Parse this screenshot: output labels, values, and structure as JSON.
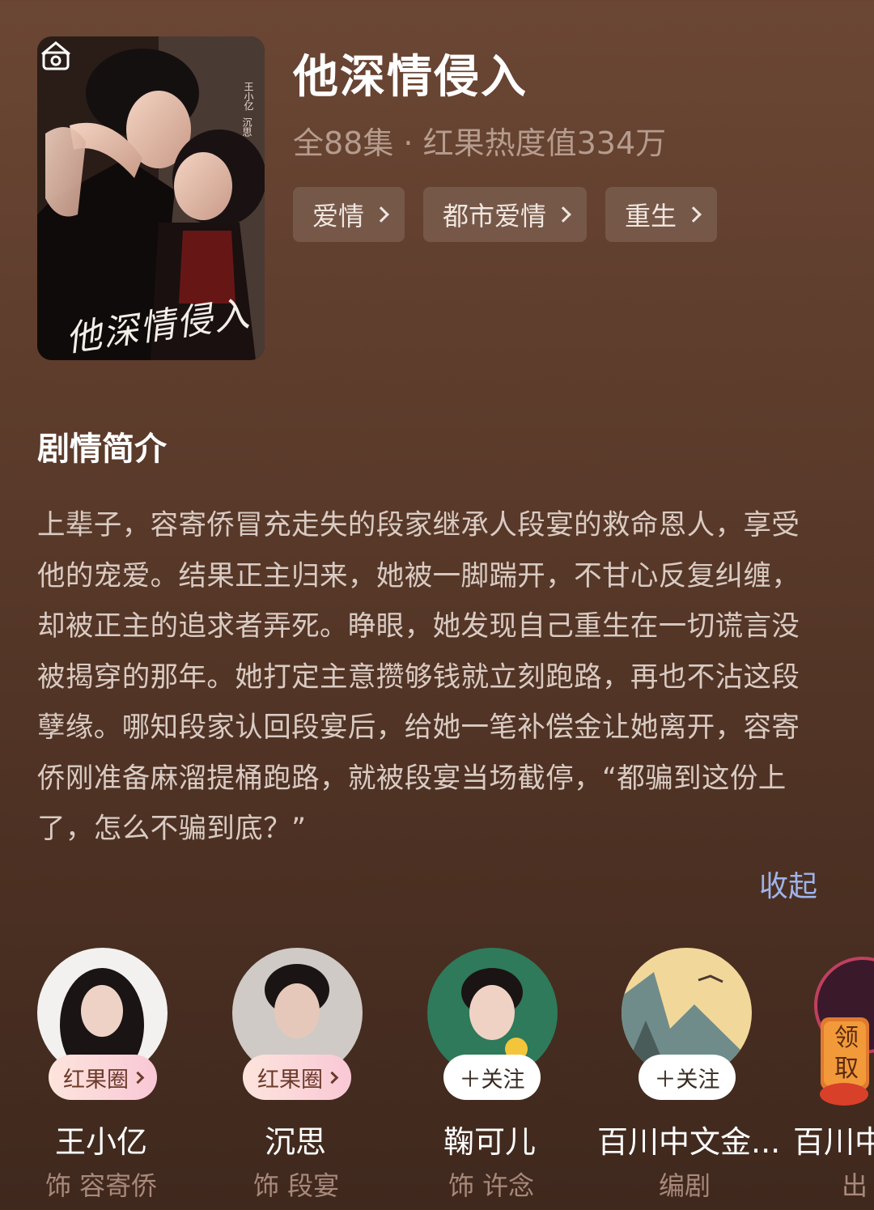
{
  "poster": {
    "title_art": "他深情侵入",
    "actor1": "王小亿",
    "actor2": "沉思"
  },
  "show": {
    "title": "他深情侵入",
    "meta": "全88集 · 红果热度值334万",
    "tags": [
      "爱情",
      "都市爱情",
      "重生"
    ]
  },
  "synopsis": {
    "heading": "剧情简介",
    "text": "上辈子，容寄侨冒充走失的段家继承人段宴的救命恩人，享受他的宠爱。结果正主归来，她被一脚踹开，不甘心反复纠缠，却被正主的追求者弄死。睁眼，她发现自己重生在一切谎言没被揭穿的那年。她打定主意攒够钱就立刻跑路，再也不沾这段孽缘。哪知段家认回段宴后，给她一笔补偿金让她离开，容寄侨刚准备麻溜提桶跑路，就被段宴当场截停，“都骗到这份上了，怎么不骗到底？”",
    "collapse_label": "收起"
  },
  "cast": [
    {
      "name": "王小亿",
      "role": "饰 容寄侨",
      "badge": "红果圈",
      "badge_type": "pink"
    },
    {
      "name": "沉思",
      "role": "饰 段宴",
      "badge": "红果圈",
      "badge_type": "pink"
    },
    {
      "name": "鞠可儿",
      "role": "饰 许念",
      "badge": "＋关注",
      "badge_type": "white"
    },
    {
      "name": "百川中文金...",
      "role": "编剧",
      "badge": "＋关注",
      "badge_type": "white"
    },
    {
      "name": "百川中",
      "role": "出",
      "badge": "",
      "badge_type": ""
    }
  ],
  "floating_widget": {
    "label": "领取"
  },
  "colors": {
    "accent_link": "#9fb3ea",
    "badge_pink": "#f9c8d6",
    "background": "#5a3a2a"
  }
}
